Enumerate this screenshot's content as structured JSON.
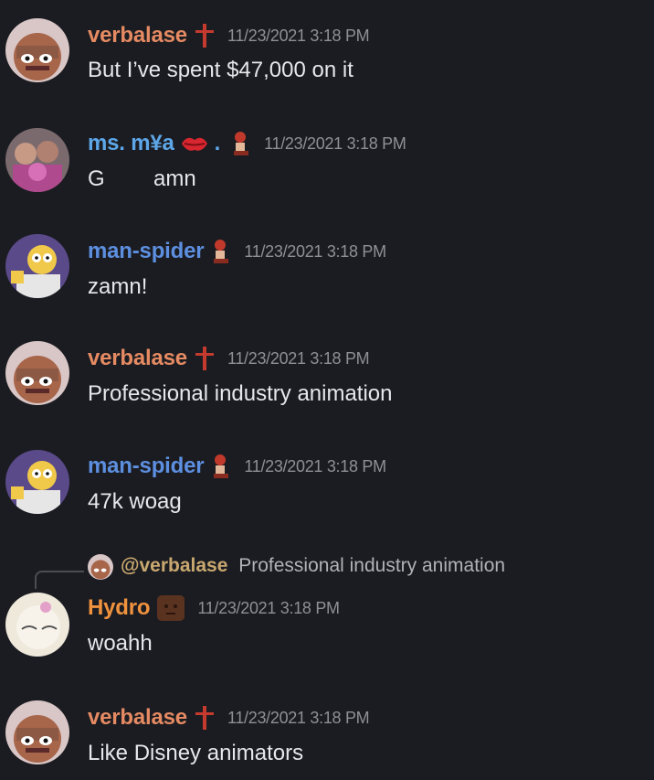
{
  "colors": {
    "background": "#1b1c21",
    "verbalase": "#e58a62",
    "ms_mya": "#5da7e8",
    "man_spider": "#5d8fe0",
    "hydro": "#f0923e",
    "timestamp": "#8e9096"
  },
  "messages": [
    {
      "user": "verbalase",
      "badge": "cross-icon",
      "timestamp": "11/23/2021 3:18 PM",
      "text": "But I’ve spent $47,000 on it"
    },
    {
      "user": "ms. m¥a",
      "badge": "kiss-lips-icon",
      "extra": ".",
      "badge2": "figure-icon",
      "timestamp": "11/23/2021 3:18 PM",
      "text": "G        amn"
    },
    {
      "user": "man-spider",
      "badge": "figure-icon",
      "timestamp": "11/23/2021 3:18 PM",
      "text": "zamn!"
    },
    {
      "user": "verbalase",
      "badge": "cross-icon",
      "timestamp": "11/23/2021 3:18 PM",
      "text": "Professional industry animation"
    },
    {
      "user": "man-spider",
      "badge": "figure-icon",
      "timestamp": "11/23/2021 3:18 PM",
      "text": "47k woag"
    },
    {
      "user": "Hydro",
      "badge": "square-emote-icon",
      "timestamp": "11/23/2021 3:18 PM",
      "text": "woahh"
    },
    {
      "user": "verbalase",
      "badge": "cross-icon",
      "timestamp": "11/23/2021 3:18 PM",
      "text": "Like Disney animators"
    }
  ],
  "reply": {
    "mention": "@verbalase",
    "content": "Professional industry animation"
  }
}
